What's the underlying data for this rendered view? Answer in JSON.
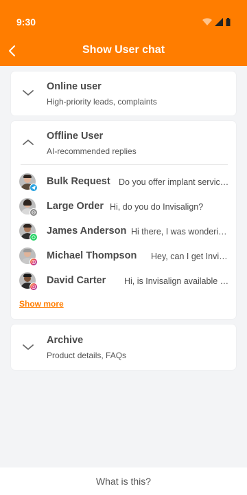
{
  "status": {
    "time": "9:30"
  },
  "header": {
    "title": "Show User chat"
  },
  "sections": {
    "online": {
      "title": "Online user",
      "subtitle": "High-priority leads, complaints"
    },
    "offline": {
      "title": "Offline User",
      "subtitle": "AI-recommended replies"
    },
    "archive": {
      "title": "Archive",
      "subtitle": "Product details, FAQs"
    }
  },
  "chats": [
    {
      "name": "Bulk Request",
      "message": "Do you offer implant service...",
      "channel": "telegram"
    },
    {
      "name": "Large Order",
      "message": "Hi, do you do Invisalign?",
      "channel": "web"
    },
    {
      "name": "James Anderson",
      "message": "Hi there, I was wondering...",
      "channel": "whatsapp"
    },
    {
      "name": "Michael Thompson",
      "message": "Hey, can I get Invisalign...",
      "channel": "instagram"
    },
    {
      "name": "David Carter",
      "message": "Hi, is Invisalign available with...",
      "channel": "instagram"
    }
  ],
  "show_more_label": "Show more",
  "bottom_bar": {
    "label": "What is this?"
  },
  "colors": {
    "accent": "#ff7d00",
    "background": "#f3f4f6"
  }
}
